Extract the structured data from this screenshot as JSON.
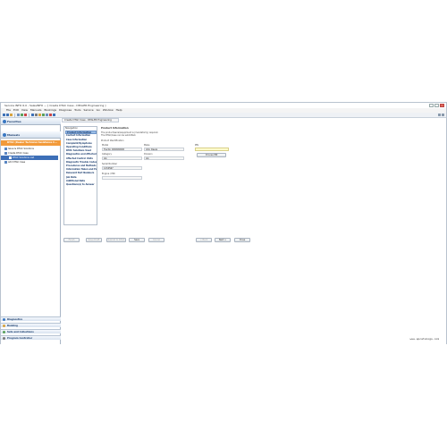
{
  "window": {
    "title": "Service INFO 6.0 - SalesINFO — [ Create DTAC Case - DEALER Engineering ]"
  },
  "menu": [
    "File",
    "Edit",
    "View",
    "Manuals",
    "Bookings",
    "Diagnose",
    "Tools",
    "Service",
    "Go",
    "Window",
    "Help"
  ],
  "sidebar": {
    "favorites_label": "Favorites",
    "manuals_label": "Manuals",
    "selected_label": "DTAC (Dealer Technical Assistance C...",
    "tree": [
      "Issue & DTAC Solutions",
      "Create DTAC Case",
      "DTAC Solutions List",
      "Add DTAC Case"
    ],
    "lower": [
      "Diagnostics",
      "Booking",
      "Sets and Collections",
      "Program Controller"
    ]
  },
  "doc_tab": "Create DTAC Case - DEALER Engineering",
  "nav": {
    "title": "Navigation",
    "items": [
      "Product Information",
      "Contact Information",
      "Case Information",
      "Complaint/Symptoms",
      "Operating Conditions",
      "DTAC Solutions Used",
      "Diagnostics and Affected",
      "Affected Control Units",
      "Diagnostic Trouble Codes",
      "Procedures and Methods",
      "Information Taken and Parts",
      "Relevant Part Numbers",
      "Job Data",
      "Additional Data",
      "Questions(s) to Answer"
    ]
  },
  "form": {
    "title": "Product Information",
    "note1": "The product/serial/equipment is (mandatorily) required.",
    "note2": "The DTAC/Case can be submitted.",
    "product_identification_label": "Product Identification",
    "model_label": "Model",
    "make_label": "Make",
    "model_value": "Tractor #######",
    "make_value": "John Deere",
    "category_label": "Category",
    "division_label": "Division",
    "category_value": "AG",
    "division_value": "AG",
    "serial_label": "Serial Number",
    "serial_value": "1234567",
    "engine_label": "Engine / PIN",
    "pin_label": "PIN",
    "pin_value": "",
    "choose_pin_button": "Choose PIN"
  },
  "buttons": {
    "finish": "Finish",
    "save_draft": "Save Draft",
    "submit_to_dtac": "Submit to DTAC",
    "save": "Save",
    "cancel": "Cancel",
    "back": "< Back",
    "next": "Next >",
    "close": "Close"
  },
  "website": "www.epcatalogs.com",
  "colors": {
    "accent": "#f29a3a",
    "nav_active": "#9bbde6",
    "header_text": "#1d3f6e"
  }
}
